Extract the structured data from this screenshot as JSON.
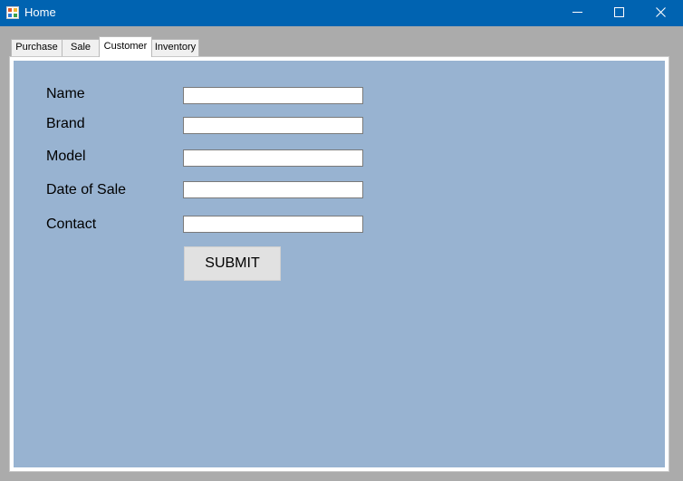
{
  "window": {
    "title": "Home",
    "icon": "app-window-icon",
    "controls": [
      "minimize-icon",
      "maximize-icon",
      "close-icon"
    ],
    "titlebar_color": "#0063b1"
  },
  "tabs": [
    {
      "label": "Purchase",
      "selected": false
    },
    {
      "label": "Sale",
      "selected": false
    },
    {
      "label": "Customer",
      "selected": true
    },
    {
      "label": "Inventory",
      "selected": false
    }
  ],
  "form": {
    "background": "#98b3d1",
    "fields": [
      {
        "label": "Name",
        "value": ""
      },
      {
        "label": "Brand",
        "value": ""
      },
      {
        "label": "Model",
        "value": ""
      },
      {
        "label": "Date of Sale",
        "value": ""
      },
      {
        "label": "Contact",
        "value": ""
      }
    ],
    "submit_label": "SUBMIT"
  }
}
